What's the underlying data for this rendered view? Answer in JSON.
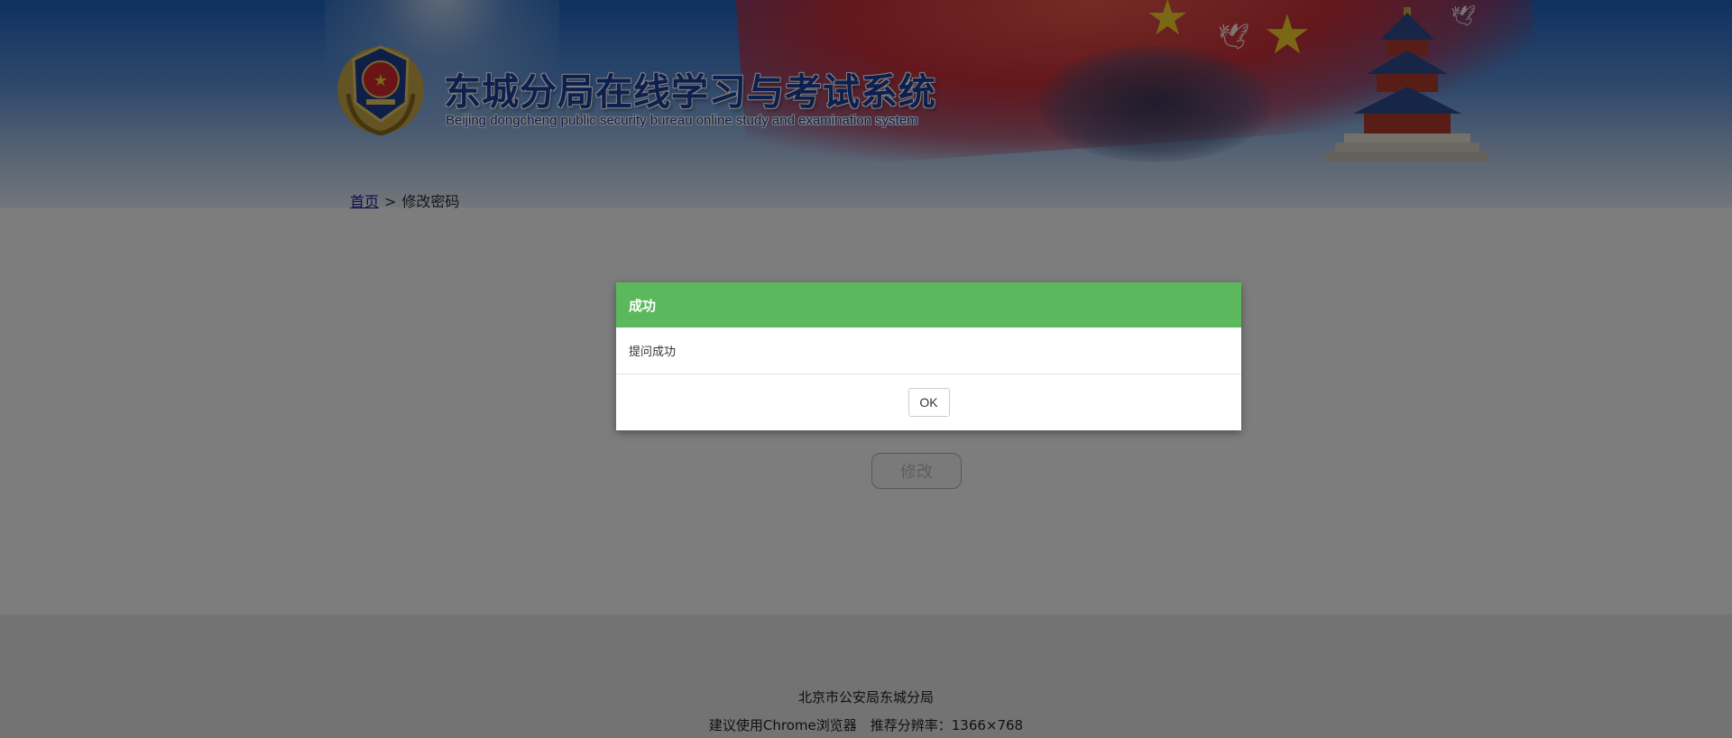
{
  "header": {
    "title": "东城分局在线学习与考试系统",
    "subtitle": "Beijing dongcheng public security bureau online study and examination system",
    "emblem_icon": "police-emblem-icon",
    "colors": {
      "title": "#1a3f9c",
      "flag": "#c8303a",
      "star": "#f7d12c"
    }
  },
  "breadcrumb": {
    "home": "首页",
    "separator": ">",
    "current": "修改密码"
  },
  "form": {
    "submit_label": "修改"
  },
  "dialog": {
    "title": "成功",
    "message": "提问成功",
    "ok_label": "OK",
    "colors": {
      "header": "#5cb85c"
    }
  },
  "footer": {
    "line1": "北京市公安局东城分局",
    "line2": "建议使用Chrome浏览器　推荐分辨率：1366×768"
  },
  "overlay": {
    "color": "#000000",
    "opacity": 0.5
  }
}
